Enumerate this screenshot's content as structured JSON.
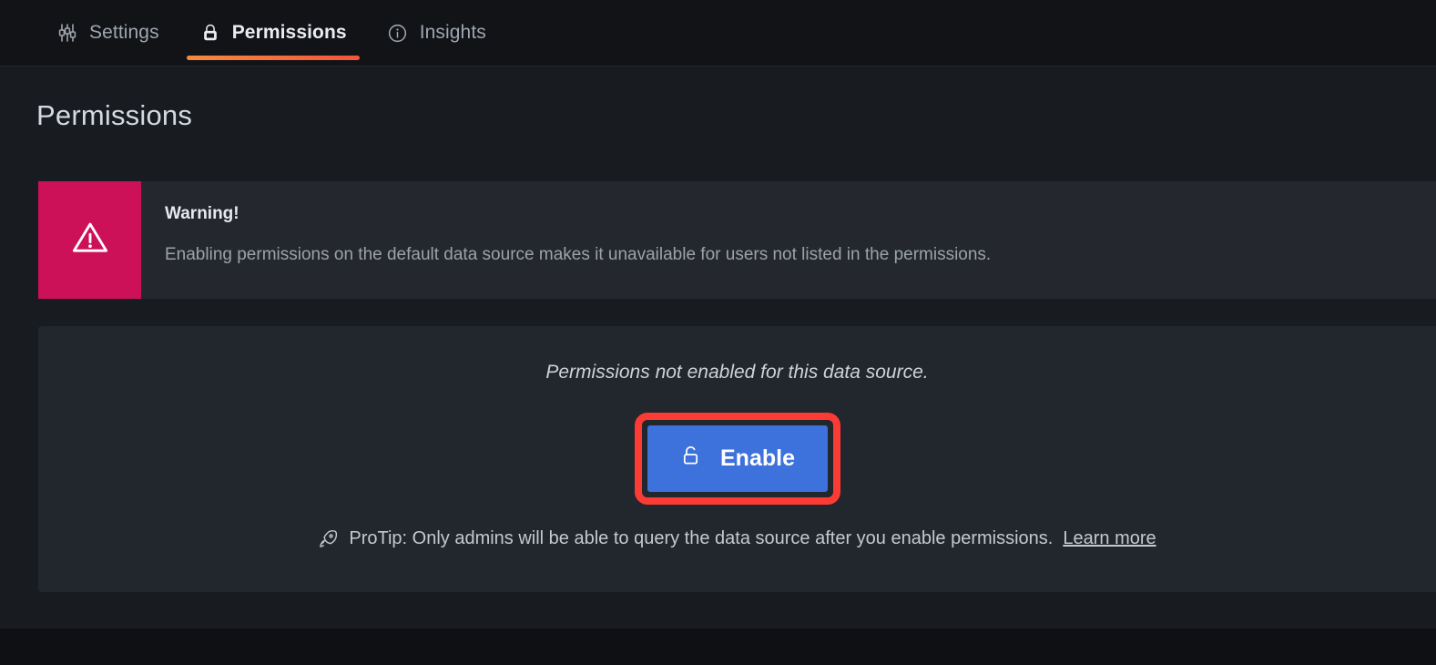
{
  "tabs": [
    {
      "label": "Settings",
      "icon": "sliders-icon",
      "active": false
    },
    {
      "label": "Permissions",
      "icon": "lock-icon",
      "active": true
    },
    {
      "label": "Insights",
      "icon": "info-circle-icon",
      "active": false
    }
  ],
  "page": {
    "title": "Permissions"
  },
  "warning": {
    "icon": "warning-triangle-icon",
    "title": "Warning!",
    "text": "Enabling permissions on the default data source makes it unavailable for users not listed in the permissions.",
    "background_color": "#CC1159"
  },
  "panel": {
    "note": "Permissions not enabled for this data source.",
    "enable_button": {
      "label": "Enable",
      "icon": "unlock-icon",
      "color": "#3D71DB",
      "highlight_color": "#FB3B34"
    },
    "protip": {
      "icon": "rocket-icon",
      "text": "ProTip: Only admins will be able to query the data source after you enable permissions.",
      "link_label": "Learn more"
    }
  },
  "theme": {
    "accent_gradient_start": "#F68A3C",
    "accent_gradient_end": "#F2543B",
    "page_background": "#181B1F",
    "chrome_background": "#111317"
  }
}
